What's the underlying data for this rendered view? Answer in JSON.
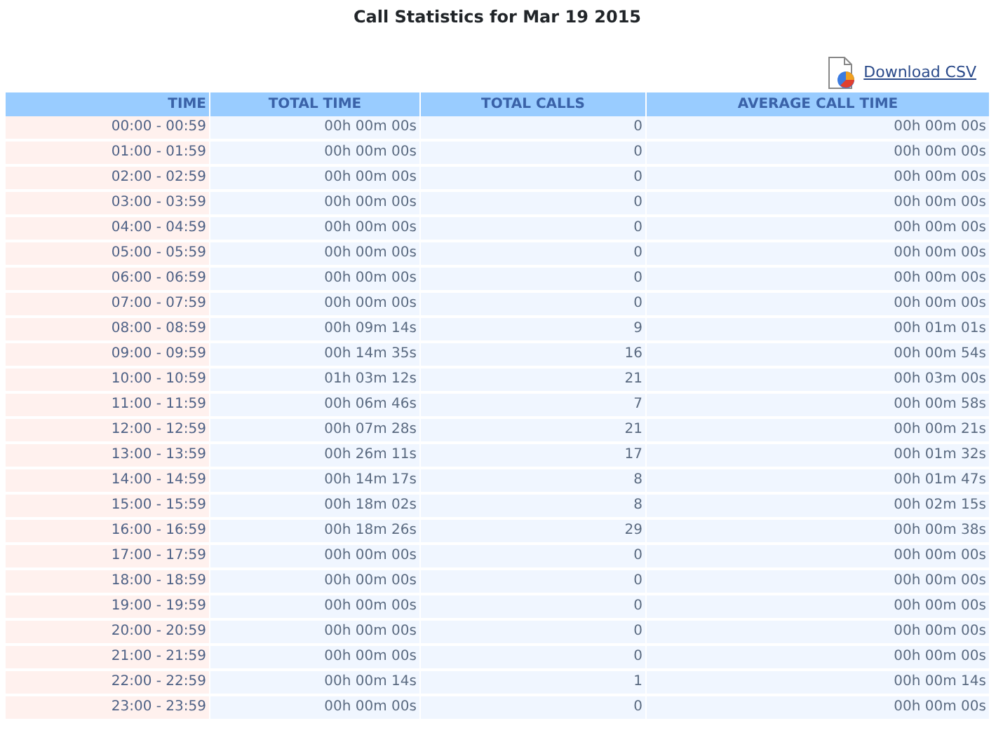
{
  "title": "Call Statistics for Mar 19 2015",
  "download": {
    "label": "Download CSV"
  },
  "table": {
    "columns": [
      "TIME",
      "TOTAL TIME",
      "TOTAL CALLS",
      "AVERAGE CALL TIME"
    ],
    "rows": [
      [
        "00:00 - 00:59",
        "00h 00m 00s",
        "0",
        "00h 00m 00s"
      ],
      [
        "01:00 - 01:59",
        "00h 00m 00s",
        "0",
        "00h 00m 00s"
      ],
      [
        "02:00 - 02:59",
        "00h 00m 00s",
        "0",
        "00h 00m 00s"
      ],
      [
        "03:00 - 03:59",
        "00h 00m 00s",
        "0",
        "00h 00m 00s"
      ],
      [
        "04:00 - 04:59",
        "00h 00m 00s",
        "0",
        "00h 00m 00s"
      ],
      [
        "05:00 - 05:59",
        "00h 00m 00s",
        "0",
        "00h 00m 00s"
      ],
      [
        "06:00 - 06:59",
        "00h 00m 00s",
        "0",
        "00h 00m 00s"
      ],
      [
        "07:00 - 07:59",
        "00h 00m 00s",
        "0",
        "00h 00m 00s"
      ],
      [
        "08:00 - 08:59",
        "00h 09m 14s",
        "9",
        "00h 01m 01s"
      ],
      [
        "09:00 - 09:59",
        "00h 14m 35s",
        "16",
        "00h 00m 54s"
      ],
      [
        "10:00 - 10:59",
        "01h 03m 12s",
        "21",
        "00h 03m 00s"
      ],
      [
        "11:00 - 11:59",
        "00h 06m 46s",
        "7",
        "00h 00m 58s"
      ],
      [
        "12:00 - 12:59",
        "00h 07m 28s",
        "21",
        "00h 00m 21s"
      ],
      [
        "13:00 - 13:59",
        "00h 26m 11s",
        "17",
        "00h 01m 32s"
      ],
      [
        "14:00 - 14:59",
        "00h 14m 17s",
        "8",
        "00h 01m 47s"
      ],
      [
        "15:00 - 15:59",
        "00h 18m 02s",
        "8",
        "00h 02m 15s"
      ],
      [
        "16:00 - 16:59",
        "00h 18m 26s",
        "29",
        "00h 00m 38s"
      ],
      [
        "17:00 - 17:59",
        "00h 00m 00s",
        "0",
        "00h 00m 00s"
      ],
      [
        "18:00 - 18:59",
        "00h 00m 00s",
        "0",
        "00h 00m 00s"
      ],
      [
        "19:00 - 19:59",
        "00h 00m 00s",
        "0",
        "00h 00m 00s"
      ],
      [
        "20:00 - 20:59",
        "00h 00m 00s",
        "0",
        "00h 00m 00s"
      ],
      [
        "21:00 - 21:59",
        "00h 00m 00s",
        "0",
        "00h 00m 00s"
      ],
      [
        "22:00 - 22:59",
        "00h 00m 14s",
        "1",
        "00h 00m 14s"
      ],
      [
        "23:00 - 23:59",
        "00h 00m 00s",
        "0",
        "00h 00m 00s"
      ]
    ]
  }
}
